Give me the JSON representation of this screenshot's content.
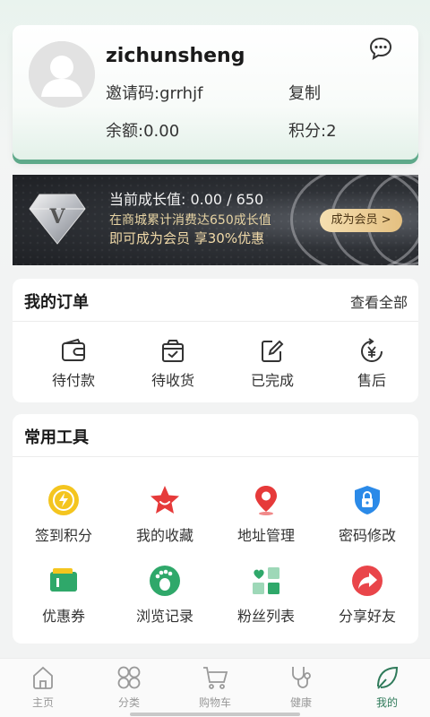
{
  "profile": {
    "username": "zichunsheng",
    "invite_code": "邀请码:grrhjf",
    "copy_label": "复制",
    "balance": "余额:0.00",
    "points": "积分:2"
  },
  "vip": {
    "badge_letter": "V",
    "growth_value": "当前成长值: 0.00 / 650",
    "line2": "在商城累计消费达650成长值",
    "line3": "即可成为会员 享30%优惠",
    "button_label": "成为会员 >"
  },
  "orders": {
    "title": "我的订单",
    "view_all": "查看全部",
    "items": [
      {
        "label": "待付款",
        "icon": "wallet-icon"
      },
      {
        "label": "待收货",
        "icon": "package-icon"
      },
      {
        "label": "已完成",
        "icon": "edit-icon"
      },
      {
        "label": "售后",
        "icon": "yen-refund-icon"
      }
    ]
  },
  "tools": {
    "title": "常用工具",
    "items": [
      {
        "label": "签到积分",
        "icon": "checkin-icon",
        "color": "#f4c51f"
      },
      {
        "label": "我的收藏",
        "icon": "star-icon",
        "color": "#e63a3a"
      },
      {
        "label": "地址管理",
        "icon": "location-icon",
        "color": "#e63a3a"
      },
      {
        "label": "密码修改",
        "icon": "lock-icon",
        "color": "#2b8ae8"
      },
      {
        "label": "优惠券",
        "icon": "coupon-icon",
        "color": "#2fa86a"
      },
      {
        "label": "浏览记录",
        "icon": "footprint-icon",
        "color": "#2fa86a"
      },
      {
        "label": "粉丝列表",
        "icon": "grid-heart-icon",
        "color": "#2fa86a"
      },
      {
        "label": "分享好友",
        "icon": "share-icon",
        "color": "#e9454a"
      }
    ]
  },
  "tabbar": {
    "tabs": [
      {
        "label": "主页",
        "icon": "home-icon"
      },
      {
        "label": "分类",
        "icon": "category-icon"
      },
      {
        "label": "购物车",
        "icon": "cart-icon"
      },
      {
        "label": "健康",
        "icon": "stethoscope-icon"
      },
      {
        "label": "我的",
        "icon": "leaf-icon",
        "active": true
      }
    ]
  },
  "colors": {
    "accent": "#2f7a5a",
    "vip_gold": "#e4c081"
  }
}
